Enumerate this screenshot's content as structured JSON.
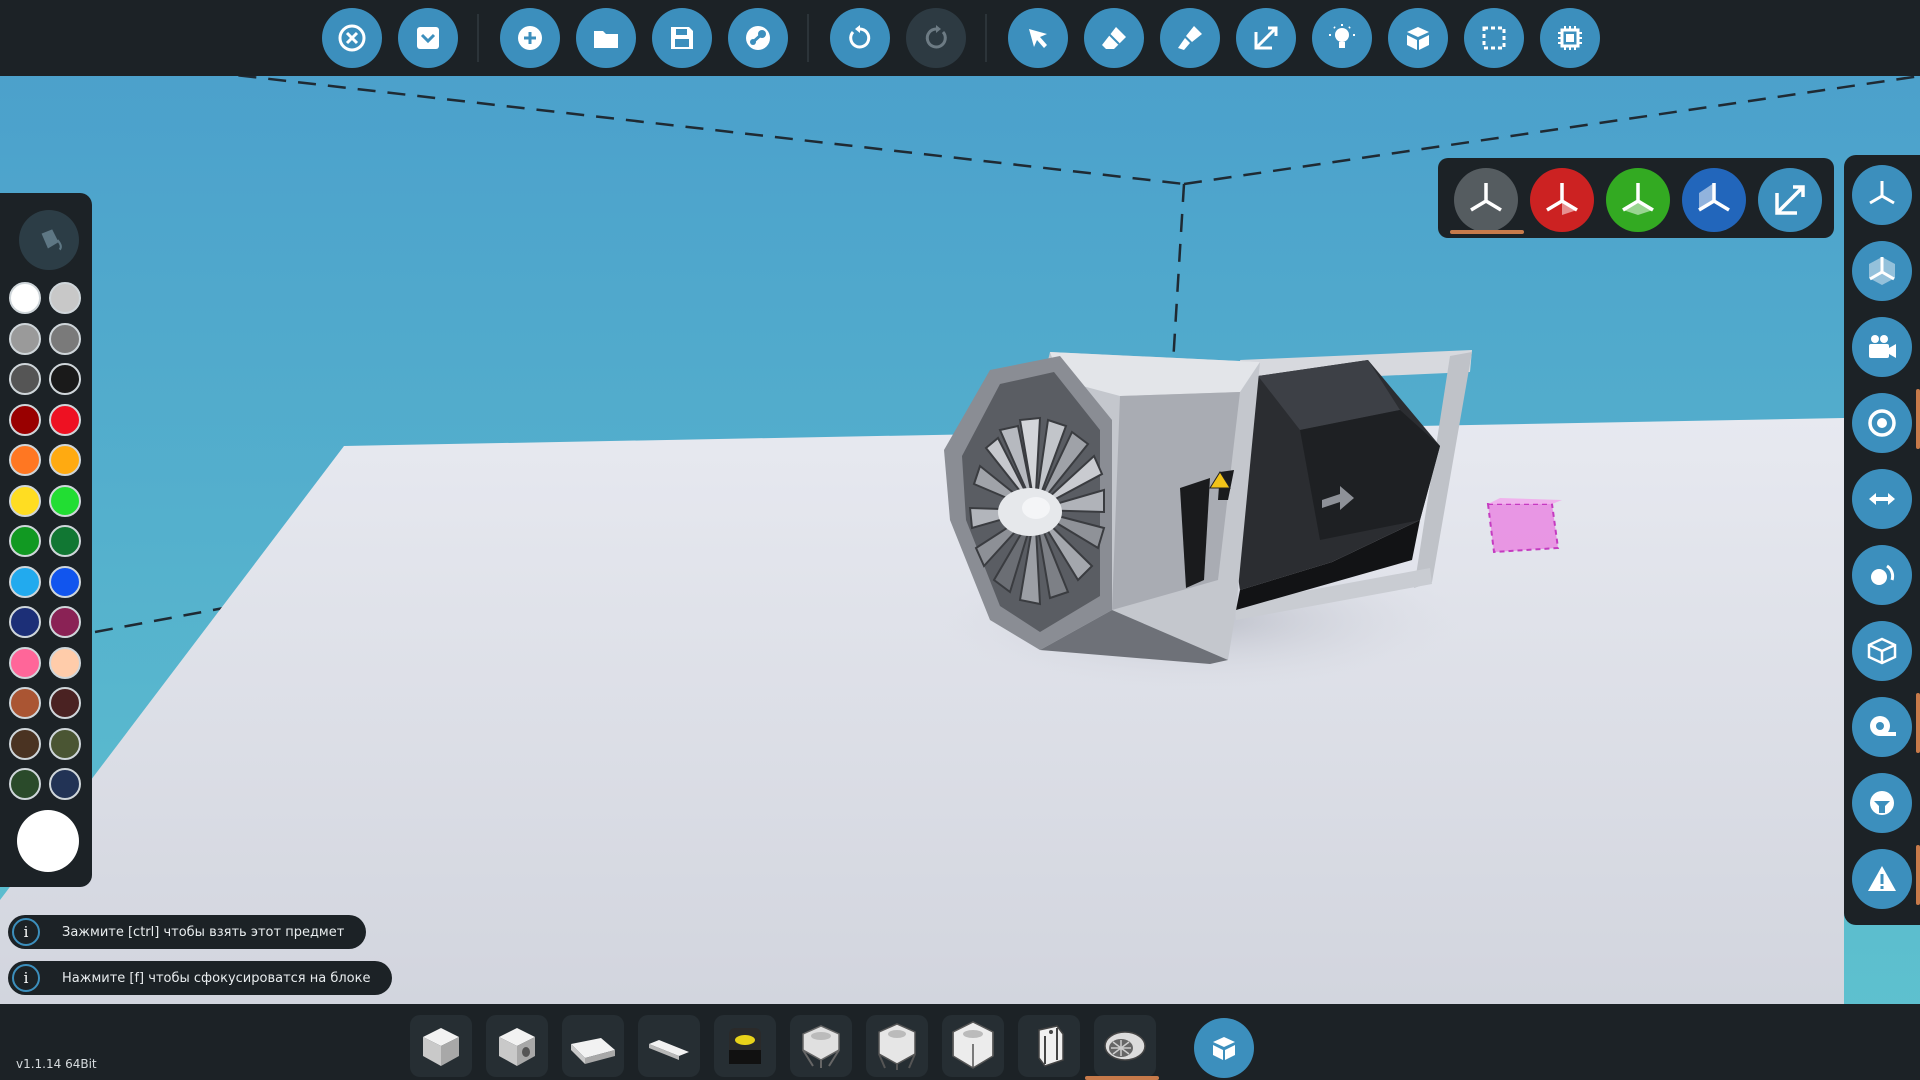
{
  "top_toolbar": {
    "buttons": [
      {
        "icon": "close-icon",
        "enabled": true
      },
      {
        "icon": "menu-down-icon",
        "enabled": true
      },
      {
        "icon": "new-icon",
        "enabled": true
      },
      {
        "icon": "open-folder-icon",
        "enabled": true
      },
      {
        "icon": "save-icon",
        "enabled": true
      },
      {
        "icon": "steam-icon",
        "enabled": true
      },
      {
        "icon": "undo-icon",
        "enabled": true
      },
      {
        "icon": "redo-icon",
        "enabled": false
      },
      {
        "icon": "select-cursor-icon",
        "enabled": true
      },
      {
        "icon": "eraser-icon",
        "enabled": true
      },
      {
        "icon": "paint-brush-icon",
        "enabled": true
      },
      {
        "icon": "move-arrows-icon",
        "enabled": true
      },
      {
        "icon": "light-bulb-icon",
        "enabled": true
      },
      {
        "icon": "blocks-icon",
        "enabled": true
      },
      {
        "icon": "selection-icon",
        "enabled": true
      },
      {
        "icon": "microprocessor-icon",
        "enabled": true
      }
    ]
  },
  "palette": {
    "colors": [
      "#ffffff",
      "#c8c8c8",
      "#9a9a9a",
      "#7a7a7a",
      "#555555",
      "#1a1a1a",
      "#990000",
      "#ee1122",
      "#ff7722",
      "#ffaa11",
      "#ffdd22",
      "#22dd33",
      "#119922",
      "#117733",
      "#22aaee",
      "#1155ee",
      "#1c2f77",
      "#8a2255",
      "#ff6699",
      "#ffccaa",
      "#aa5533",
      "#4a2222",
      "#4a3322",
      "#4a5533",
      "#2a4a2a",
      "#223355"
    ],
    "current_color": "#ffffff"
  },
  "axis_selector": {
    "buttons": [
      {
        "icon": "axis-all-icon",
        "color": "#555c60"
      },
      {
        "icon": "axis-x-icon",
        "color": "#cc2222"
      },
      {
        "icon": "axis-y-icon",
        "color": "#33aa22"
      },
      {
        "icon": "axis-z-icon",
        "color": "#2266bb"
      },
      {
        "icon": "resize-icon",
        "color": "#3c8fbd"
      }
    ],
    "selected": 0
  },
  "right_panel": {
    "buttons": [
      "axis-view-icon",
      "cube-view-icon",
      "camera-icon",
      "target-icon",
      "flip-arrows-icon",
      "rotate-view-icon",
      "box-icon",
      "tape-icon",
      "seat-icon",
      "warning-icon"
    ]
  },
  "hints": [
    {
      "icon": "i",
      "text": "Зажмите [ctrl] чтобы взять этот предмет"
    },
    {
      "icon": "i",
      "text": "Нажмите [f] чтобы сфокусироватся на блоке"
    }
  ],
  "bottom_bar": {
    "blocks": [
      "block-cube-icon",
      "block-cube-hole-icon",
      "block-slope-icon",
      "block-plate-icon",
      "block-indicator-icon",
      "block-fan-housing-icon",
      "block-fan-housing-2-icon",
      "block-fan-housing-3-icon",
      "block-frame-icon",
      "block-jet-engine-icon"
    ],
    "selected": 9
  },
  "version": "v1.1.14 64Bit"
}
